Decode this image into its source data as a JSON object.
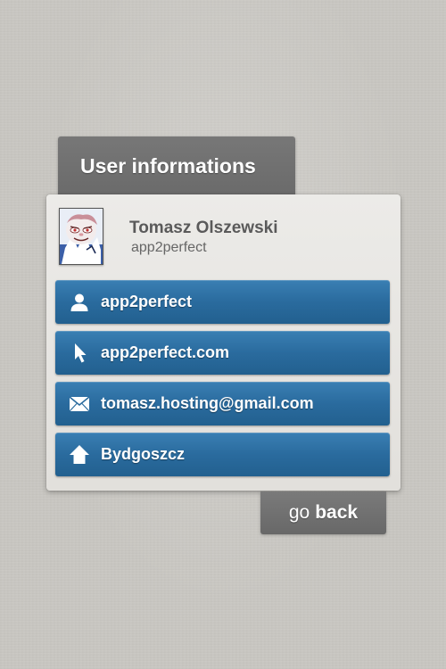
{
  "header": {
    "title": "User informations"
  },
  "profile": {
    "name": "Tomasz Olszewski",
    "username": "app2perfect",
    "avatar_icon": "cartoon-avatar-icon"
  },
  "details": [
    {
      "icon": "user-icon",
      "label": "app2perfect"
    },
    {
      "icon": "cursor-icon",
      "label": "app2perfect.com"
    },
    {
      "icon": "envelope-icon",
      "label": "tomasz.hosting@gmail.com"
    },
    {
      "icon": "home-icon",
      "label": "Bydgoszcz"
    }
  ],
  "footer": {
    "go_label": "go",
    "back_label": "back"
  },
  "colors": {
    "row_blue": "#2a6b9e",
    "tab_gray": "#707070",
    "card_bg": "#e6e4e0",
    "background": "#c9c7c2"
  }
}
